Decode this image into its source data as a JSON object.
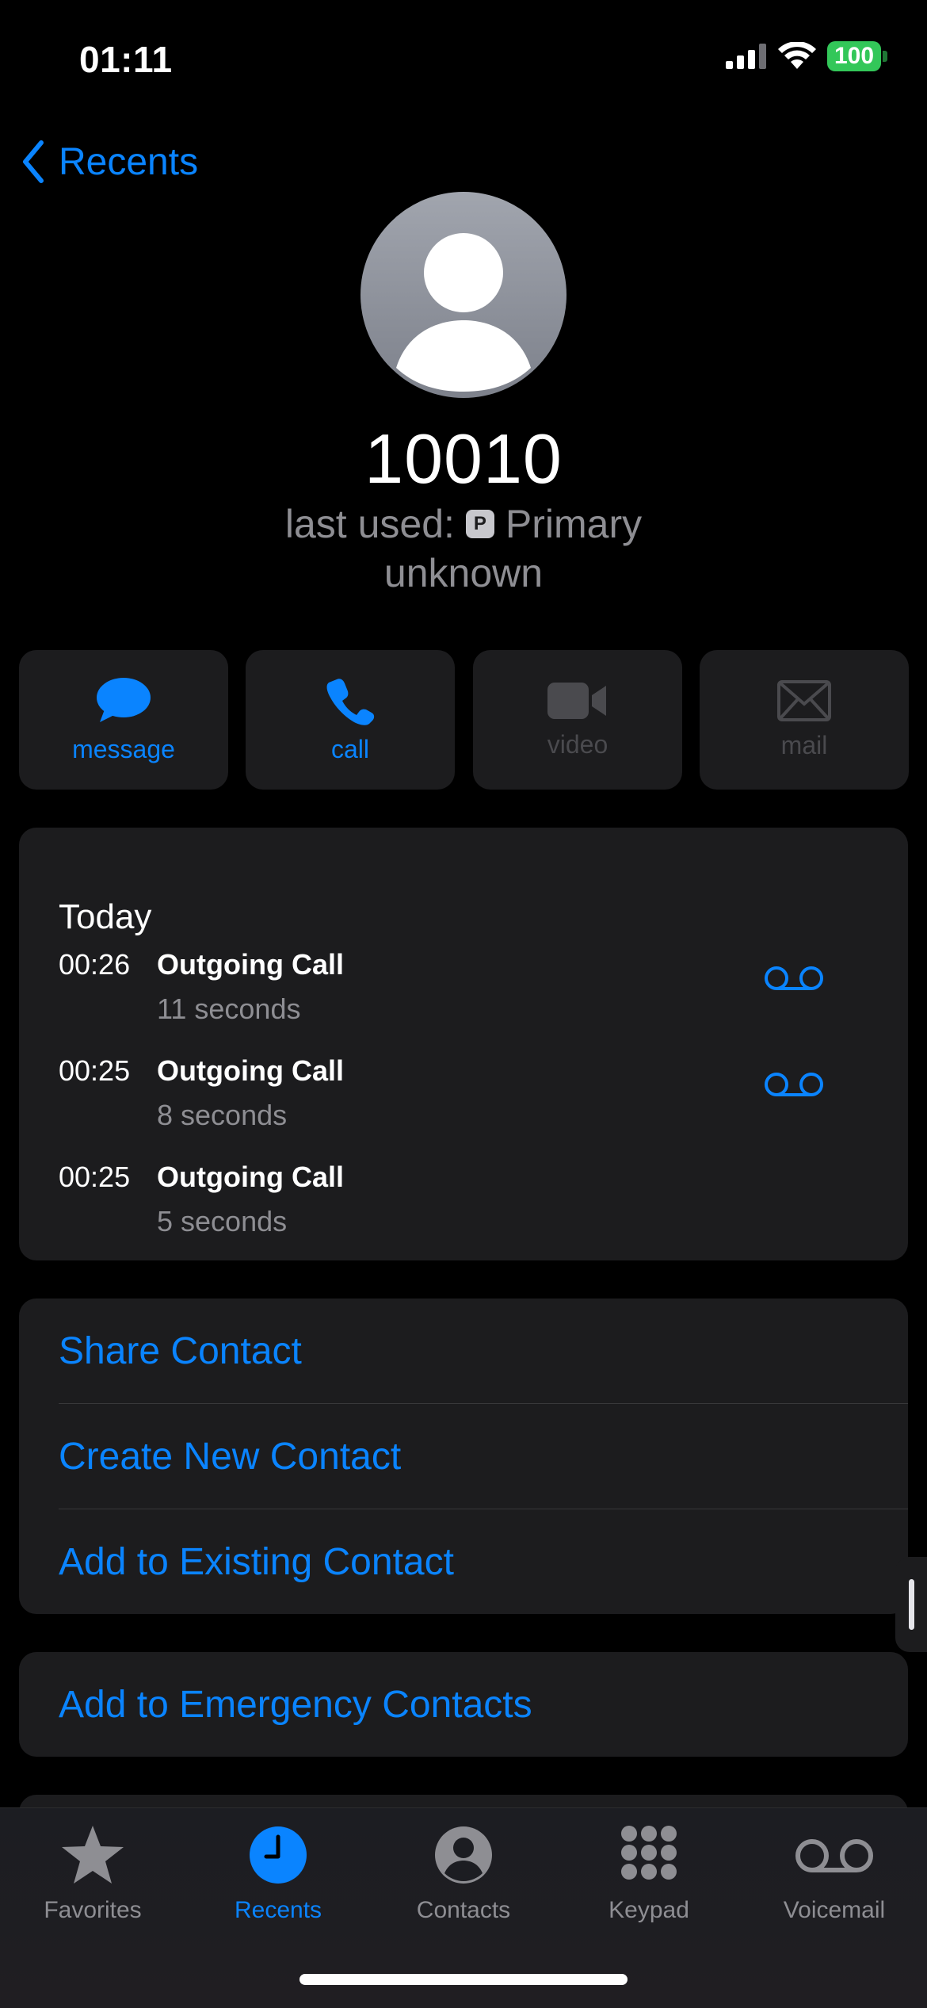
{
  "status": {
    "time": "01:11",
    "battery": "100"
  },
  "nav": {
    "back_label": "Recents"
  },
  "contact": {
    "name": "10010",
    "last_used_prefix": "last used:",
    "line_badge": "P",
    "line_name": "Primary",
    "label": "unknown"
  },
  "actions": [
    {
      "label": "message",
      "icon": "message-icon",
      "enabled": true
    },
    {
      "label": "call",
      "icon": "phone-icon",
      "enabled": true
    },
    {
      "label": "video",
      "icon": "video-icon",
      "enabled": false
    },
    {
      "label": "mail",
      "icon": "mail-icon",
      "enabled": false
    }
  ],
  "history": {
    "title": "Today",
    "calls": [
      {
        "time": "00:26",
        "type": "Outgoing Call",
        "duration": "11 seconds",
        "voicemail": true
      },
      {
        "time": "00:25",
        "type": "Outgoing Call",
        "duration": "8 seconds",
        "voicemail": true
      },
      {
        "time": "00:25",
        "type": "Outgoing Call",
        "duration": "5 seconds",
        "voicemail": false
      }
    ]
  },
  "options": {
    "share": "Share Contact",
    "create": "Create New Contact",
    "add_existing": "Add to Existing Contact"
  },
  "emergency": {
    "label": "Add to Emergency Contacts"
  },
  "tabs": [
    {
      "label": "Favorites",
      "icon": "star-icon"
    },
    {
      "label": "Recents",
      "icon": "clock-icon",
      "active": true
    },
    {
      "label": "Contacts",
      "icon": "person-circle-icon"
    },
    {
      "label": "Keypad",
      "icon": "keypad-icon"
    },
    {
      "label": "Voicemail",
      "icon": "voicemail-icon"
    }
  ],
  "colors": {
    "accent": "#0a84ff",
    "card": "#1c1c1e",
    "battery": "#33c759",
    "secondary_text": "#8e8e93"
  }
}
